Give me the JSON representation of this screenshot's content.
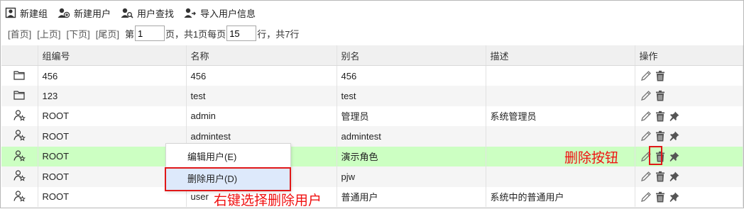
{
  "toolbar": {
    "new_group": "新建组",
    "new_user": "新建用户",
    "find_user": "用户查找",
    "import_user": "导入用户信息"
  },
  "pager": {
    "first": "[首页]",
    "prev": "[上页]",
    "next": "[下页]",
    "last": "[尾页]",
    "page_prefix": "第",
    "page_value": "1",
    "page_suffix": "页，共1页每页",
    "size_value": "15",
    "size_suffix": "行，共7行"
  },
  "table": {
    "headers": {
      "group": "组编号",
      "name": "名称",
      "alias": "别名",
      "desc": "描述",
      "ops": "操作"
    },
    "rows": [
      {
        "type": "group",
        "group": "456",
        "name": "456",
        "alias": "456",
        "desc": ""
      },
      {
        "type": "group",
        "group": "123",
        "name": "test",
        "alias": "test",
        "desc": ""
      },
      {
        "type": "user",
        "group": "ROOT",
        "name": "admin",
        "alias": "管理员",
        "desc": "系统管理员"
      },
      {
        "type": "user",
        "group": "ROOT",
        "name": "admintest",
        "alias": "admintest",
        "desc": ""
      },
      {
        "type": "user",
        "group": "ROOT",
        "name": "",
        "alias": "演示角色",
        "desc": ""
      },
      {
        "type": "user",
        "group": "ROOT",
        "name": "",
        "alias": "pjw",
        "desc": ""
      },
      {
        "type": "user",
        "group": "ROOT",
        "name": "user",
        "alias": "普通用户",
        "desc": "系统中的普通用户"
      }
    ]
  },
  "context_menu": {
    "edit": "编辑用户(E)",
    "delete": "删除用户(D)"
  },
  "annotations": {
    "delete_button_note": "删除按钮",
    "right_click_note": "右键选择删除用户"
  },
  "colors": {
    "selected_row": "#ccffc2",
    "annotation": "#f01010",
    "menu_highlight": "#dde9fb"
  }
}
